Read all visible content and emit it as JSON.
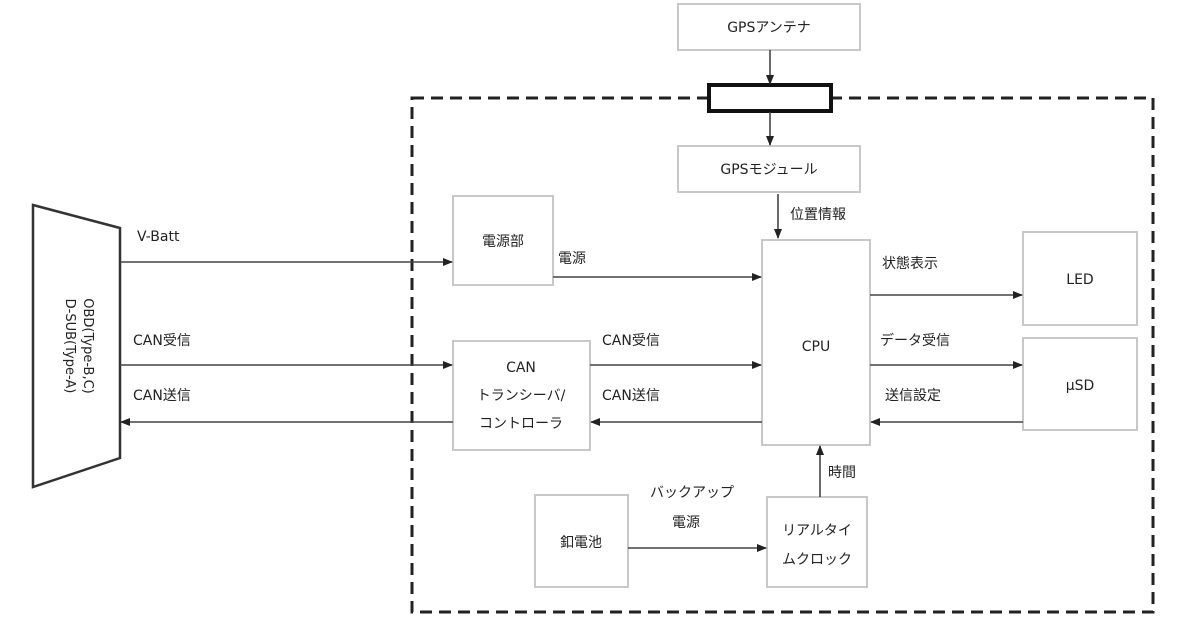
{
  "blocks": {
    "gps_antenna": "GPSアンテナ",
    "gps_module": "GPSモジュール",
    "power_unit": "電源部",
    "can_line1": "CAN",
    "can_line2": "トランシーバ/",
    "can_line3": "コントローラ",
    "cpu": "CPU",
    "led": "LED",
    "usd": "μSD",
    "battery": "釦電池",
    "rtc_line1": "リアルタイ",
    "rtc_line2": "ムクロック",
    "connector_line1": "OBD(Type-B,C)",
    "connector_line2": "D-SUB(Type-A)"
  },
  "labels": {
    "position": "位置情報",
    "vbatt": "V-Batt",
    "power": "電源",
    "can_rx_left": "CAN受信",
    "can_tx_left": "CAN送信",
    "can_rx_mid": "CAN受信",
    "can_tx_mid": "CAN送信",
    "status": "状態表示",
    "data_rx": "データ受信",
    "tx_setting": "送信設定",
    "time": "時間",
    "backup1": "バックアップ",
    "backup2": "電源"
  }
}
